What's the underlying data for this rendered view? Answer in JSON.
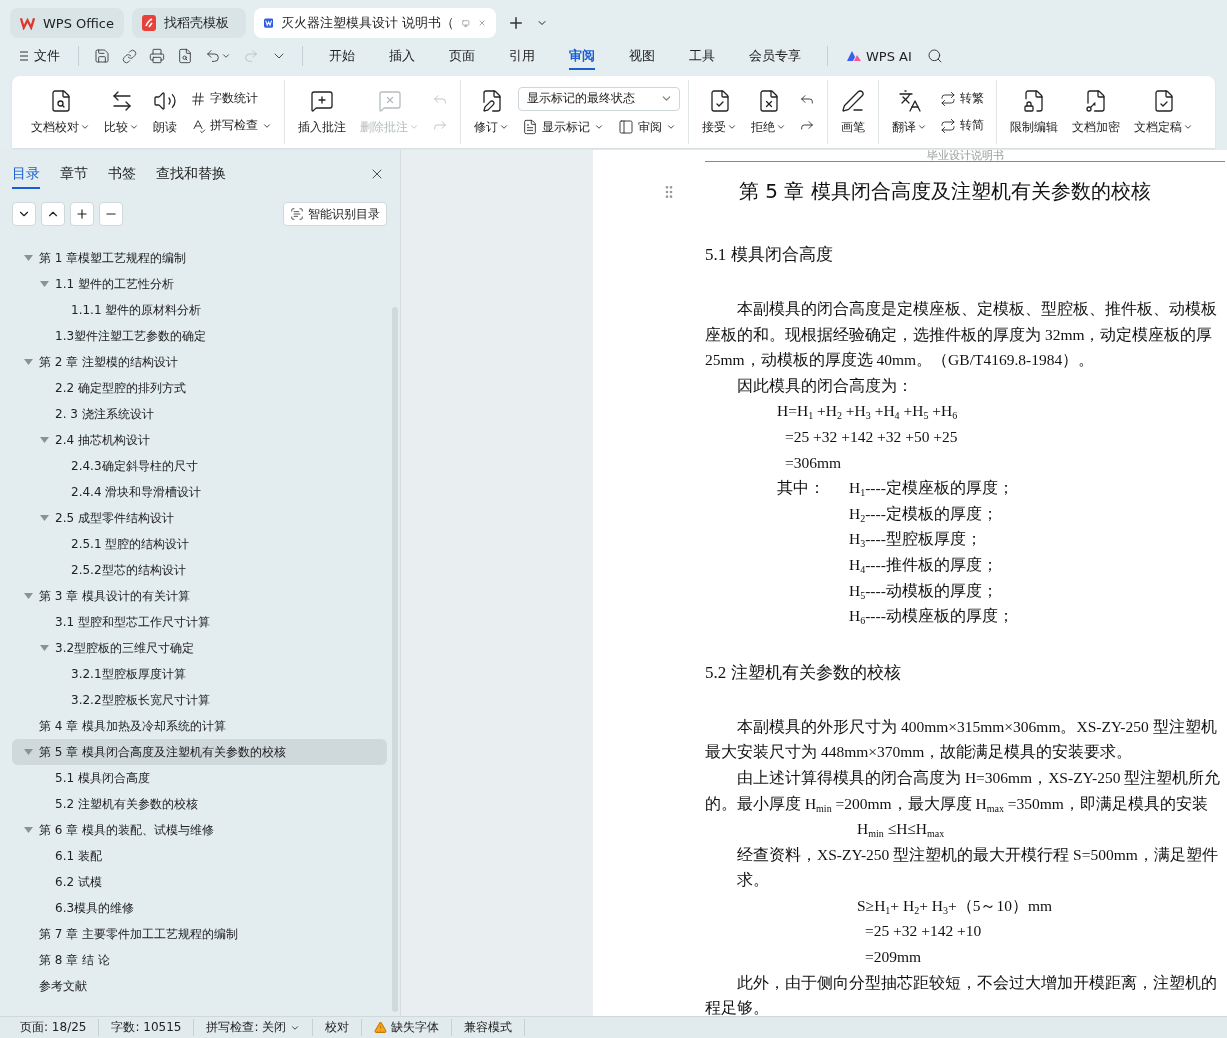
{
  "window_tabs": [
    {
      "kind": "home",
      "label": "WPS Office",
      "selected": false
    },
    {
      "kind": "template",
      "label": "找稻壳模板",
      "selected": false
    },
    {
      "kind": "doc",
      "label": "灭火器注塑模具设计 说明书（",
      "selected": true
    }
  ],
  "menu": {
    "file": "文件",
    "tabs": [
      {
        "label": "开始",
        "selected": false
      },
      {
        "label": "插入",
        "selected": false
      },
      {
        "label": "页面",
        "selected": false
      },
      {
        "label": "引用",
        "selected": false
      },
      {
        "label": "审阅",
        "selected": true
      },
      {
        "label": "视图",
        "selected": false
      },
      {
        "label": "工具",
        "selected": false
      },
      {
        "label": "会员专享",
        "selected": false
      }
    ],
    "ai": "WPS AI"
  },
  "ribbon": {
    "groups": [
      {
        "items": [
          {
            "kind": "large",
            "label": "文档校对",
            "dropdown": true,
            "disabled": false
          },
          {
            "kind": "large",
            "label": "比较",
            "dropdown": true,
            "disabled": false
          },
          {
            "kind": "large",
            "label": "朗读",
            "dropdown": false,
            "disabled": false
          },
          {
            "kind": "stack",
            "rows": [
              {
                "label": "字数统计",
                "dropdown": false,
                "disabled": false
              },
              {
                "label": "拼写检查",
                "dropdown": true,
                "disabled": false
              }
            ]
          }
        ]
      },
      {
        "items": [
          {
            "kind": "large",
            "label": "插入批注",
            "dropdown": false,
            "disabled": false
          },
          {
            "kind": "large",
            "label": "删除批注",
            "dropdown": true,
            "disabled": true
          },
          {
            "kind": "stack",
            "rows": [
              {
                "dropdown": false,
                "disabled": true
              },
              {
                "dropdown": false,
                "disabled": true
              }
            ]
          }
        ]
      },
      {
        "items": [
          {
            "kind": "large",
            "label": "修订",
            "dropdown": true,
            "disabled": false
          },
          {
            "kind": "select",
            "value": "显示标记的最终状态",
            "rows": [
              {
                "label": "显示标记",
                "dropdown": true,
                "disabled": false
              },
              {
                "label": "审阅",
                "dropdown": true,
                "disabled": false
              }
            ]
          }
        ]
      },
      {
        "items": [
          {
            "kind": "large",
            "label": "接受",
            "dropdown": true,
            "disabled": false
          },
          {
            "kind": "large",
            "label": "拒绝",
            "dropdown": true,
            "disabled": false
          },
          {
            "kind": "stack",
            "rows": [
              {
                "dropdown": false,
                "disabled": false
              },
              {
                "dropdown": false,
                "disabled": false
              }
            ]
          }
        ]
      },
      {
        "items": [
          {
            "kind": "large",
            "label": "画笔",
            "dropdown": false,
            "disabled": false
          }
        ]
      },
      {
        "items": [
          {
            "kind": "large",
            "label": "翻译",
            "dropdown": true,
            "disabled": false
          },
          {
            "kind": "stack",
            "rows": [
              {
                "label": "转繁",
                "dropdown": false,
                "disabled": false
              },
              {
                "label": "转简",
                "dropdown": false,
                "disabled": false
              }
            ]
          }
        ]
      },
      {
        "items": [
          {
            "kind": "large",
            "label": "限制编辑",
            "dropdown": false,
            "disabled": false
          },
          {
            "kind": "large",
            "label": "文档加密",
            "dropdown": false,
            "disabled": false
          },
          {
            "kind": "large",
            "label": "文档定稿",
            "dropdown": true,
            "disabled": false
          }
        ]
      }
    ]
  },
  "sidebar": {
    "tabs": [
      {
        "label": "目录",
        "selected": true
      },
      {
        "label": "章节",
        "selected": false
      },
      {
        "label": "书签",
        "selected": false
      },
      {
        "label": "查找和替换",
        "selected": false
      }
    ],
    "smart_button": "智能识别目录",
    "toc": [
      {
        "label": "第 1 章模塑工艺规程的编制",
        "selected": false,
        "expanded": true,
        "children": [
          {
            "label": "1.1  塑件的工艺性分析",
            "selected": false,
            "expanded": true,
            "children": [
              {
                "label": "1.1.1    塑件的原材料分析",
                "selected": false
              }
            ]
          },
          {
            "label": "1.3塑件注塑工艺参数的确定",
            "selected": false
          }
        ]
      },
      {
        "label": "第 2 章  注塑模的结构设计",
        "selected": false,
        "expanded": true,
        "children": [
          {
            "label": "2.2  确定型腔的排列方式",
            "selected": false
          },
          {
            "label": "2.  3  浇注系统设计",
            "selected": false
          },
          {
            "label": "2.4  抽芯机构设计",
            "selected": false,
            "expanded": true,
            "children": [
              {
                "label": "2.4.3确定斜导柱的尺寸",
                "selected": false
              },
              {
                "label": "2.4.4  滑块和导滑槽设计",
                "selected": false
              }
            ]
          },
          {
            "label": "2.5  成型零件结构设计",
            "selected": false,
            "expanded": true,
            "children": [
              {
                "label": "2.5.1  型腔的结构设计",
                "selected": false
              },
              {
                "label": "2.5.2型芯的结构设计",
                "selected": false
              }
            ]
          }
        ]
      },
      {
        "label": "第 3 章  模具设计的有关计算",
        "selected": false,
        "expanded": true,
        "children": [
          {
            "label": "3.1  型腔和型芯工作尺寸计算",
            "selected": false
          },
          {
            "label": "3.2型腔板的三维尺寸确定",
            "selected": false,
            "expanded": true,
            "children": [
              {
                "label": "3.2.1型腔板厚度计算",
                "selected": false
              },
              {
                "label": "3.2.2型腔板长宽尺寸计算",
                "selected": false
              }
            ]
          }
        ]
      },
      {
        "label": "第 4 章  模具加热及冷却系统的计算",
        "selected": false
      },
      {
        "label": "第 5 章  模具闭合高度及注塑机有关参数的校核",
        "selected": true,
        "expanded": true,
        "children": [
          {
            "label": "5.1  模具闭合高度",
            "selected": false
          },
          {
            "label": "5.2  注塑机有关参数的校核",
            "selected": false
          }
        ]
      },
      {
        "label": "第 6 章  模具的装配、试模与维修",
        "selected": false,
        "expanded": true,
        "children": [
          {
            "label": "6.1  装配",
            "selected": false
          },
          {
            "label": "6.2  试模",
            "selected": false
          },
          {
            "label": "6.3模具的维修",
            "selected": false
          }
        ]
      },
      {
        "label": "第 7 章  主要零件加工工艺规程的编制",
        "selected": false
      },
      {
        "label": "第 8 章  结    论",
        "selected": false
      },
      {
        "label": "参考文献",
        "selected": false
      }
    ]
  },
  "document": {
    "header": "毕业设计说明书",
    "title": "第 5 章  模具闭合高度及注塑机有关参数的校核",
    "sections": [
      {
        "heading": "5.1  模具闭合高度",
        "lines": [
          {
            "kind": "indent",
            "text": "本副模具的闭合高度是定模座板、定模板、型腔板、推件板、动模板"
          },
          {
            "kind": "plain",
            "text": "座板的和。现根据经验确定，选推件板的厚度为 32mm，动定模座板的厚"
          },
          {
            "kind": "plain",
            "text": "25mm，动模板的厚度选 40mm。（GB/T4169.8-1984）。"
          },
          {
            "kind": "indent",
            "text": "因此模具的闭合高度为："
          },
          {
            "kind": "eq",
            "text": "H=H$_{1}$ +H$_{2}$ +H$_{3}$ +H$_{4}$ +H$_{5}$ +H$_{6}$"
          },
          {
            "kind": "eq-cont",
            "text": "=25 +32 +142 +32 +50 +25"
          },
          {
            "kind": "eq-cont",
            "text": "=306mm"
          },
          {
            "kind": "where",
            "label": "其中：",
            "text": "H$_{1}$----定模座板的厚度；"
          },
          {
            "kind": "def",
            "text": "H$_{2}$----定模板的厚度；"
          },
          {
            "kind": "def",
            "text": "H$_{3}$----型腔板厚度；"
          },
          {
            "kind": "def",
            "text": "H$_{4}$----推件板的厚度；"
          },
          {
            "kind": "def",
            "text": "H$_{5}$----动模板的厚度；"
          },
          {
            "kind": "def",
            "text": "H$_{6}$----动模座板的厚度；"
          }
        ]
      },
      {
        "heading": "5.2  注塑机有关参数的校核",
        "lines": [
          {
            "kind": "indent",
            "text": "本副模具的外形尺寸为 400mm×315mm×306mm。XS-ZY-250 型注塑机"
          },
          {
            "kind": "plain",
            "text": "最大安装尺寸为 448mm×370mm，故能满足模具的安装要求。"
          },
          {
            "kind": "indent",
            "text": "由上述计算得模具的闭合高度为 H=306mm，XS-ZY-250 型注塑机所允"
          },
          {
            "kind": "plain",
            "text": "的。最小厚度 H$_{min}$ =200mm，最大厚度 H$_{max}$ =350mm，即满足模具的安装"
          },
          {
            "kind": "center",
            "text": "H$_{min}$ ≤H≤H$_{max}$"
          },
          {
            "kind": "indent",
            "text": "经查资料，XS-ZY-250 型注塑机的最大开模行程 S=500mm，满足塑件"
          },
          {
            "kind": "indent",
            "text": "求。"
          },
          {
            "kind": "center",
            "text": "S≥H$_{1}$+ H$_{2}$+ H$_{3}$+（5～10）mm"
          },
          {
            "kind": "center-cont",
            "text": "=25 +32 +142 +10"
          },
          {
            "kind": "center-cont",
            "text": "=209mm"
          },
          {
            "kind": "indent",
            "text": "此外，由于侧向分型抽芯距较短，不会过大增加开模距离，注塑机的"
          },
          {
            "kind": "plain",
            "text": "程足够。"
          }
        ]
      }
    ]
  },
  "status_bar": [
    {
      "kind": "text",
      "label": "页面: 18/25"
    },
    {
      "kind": "text",
      "label": "字数: 10515"
    },
    {
      "kind": "dropdown",
      "label": "拼写检查: 关闭"
    },
    {
      "kind": "text",
      "label": "校对"
    },
    {
      "kind": "warning",
      "label": "缺失字体"
    },
    {
      "kind": "text",
      "label": "兼容模式"
    }
  ]
}
